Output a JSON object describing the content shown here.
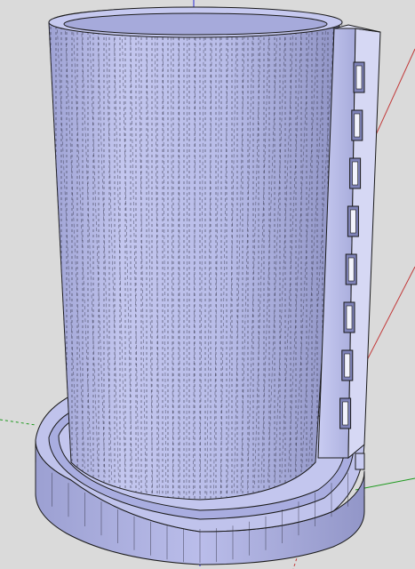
{
  "viewport": {
    "background": "#dadada",
    "model_face_color": "#b7bbe6",
    "model_face_shadow": "#8e92c2",
    "model_face_light": "#d2d5f2",
    "edge_color": "#1a1a1a",
    "axis_colors": {
      "red": "#c23a3a",
      "green": "#1f9a1f",
      "blue": "#2a2ad8"
    }
  }
}
